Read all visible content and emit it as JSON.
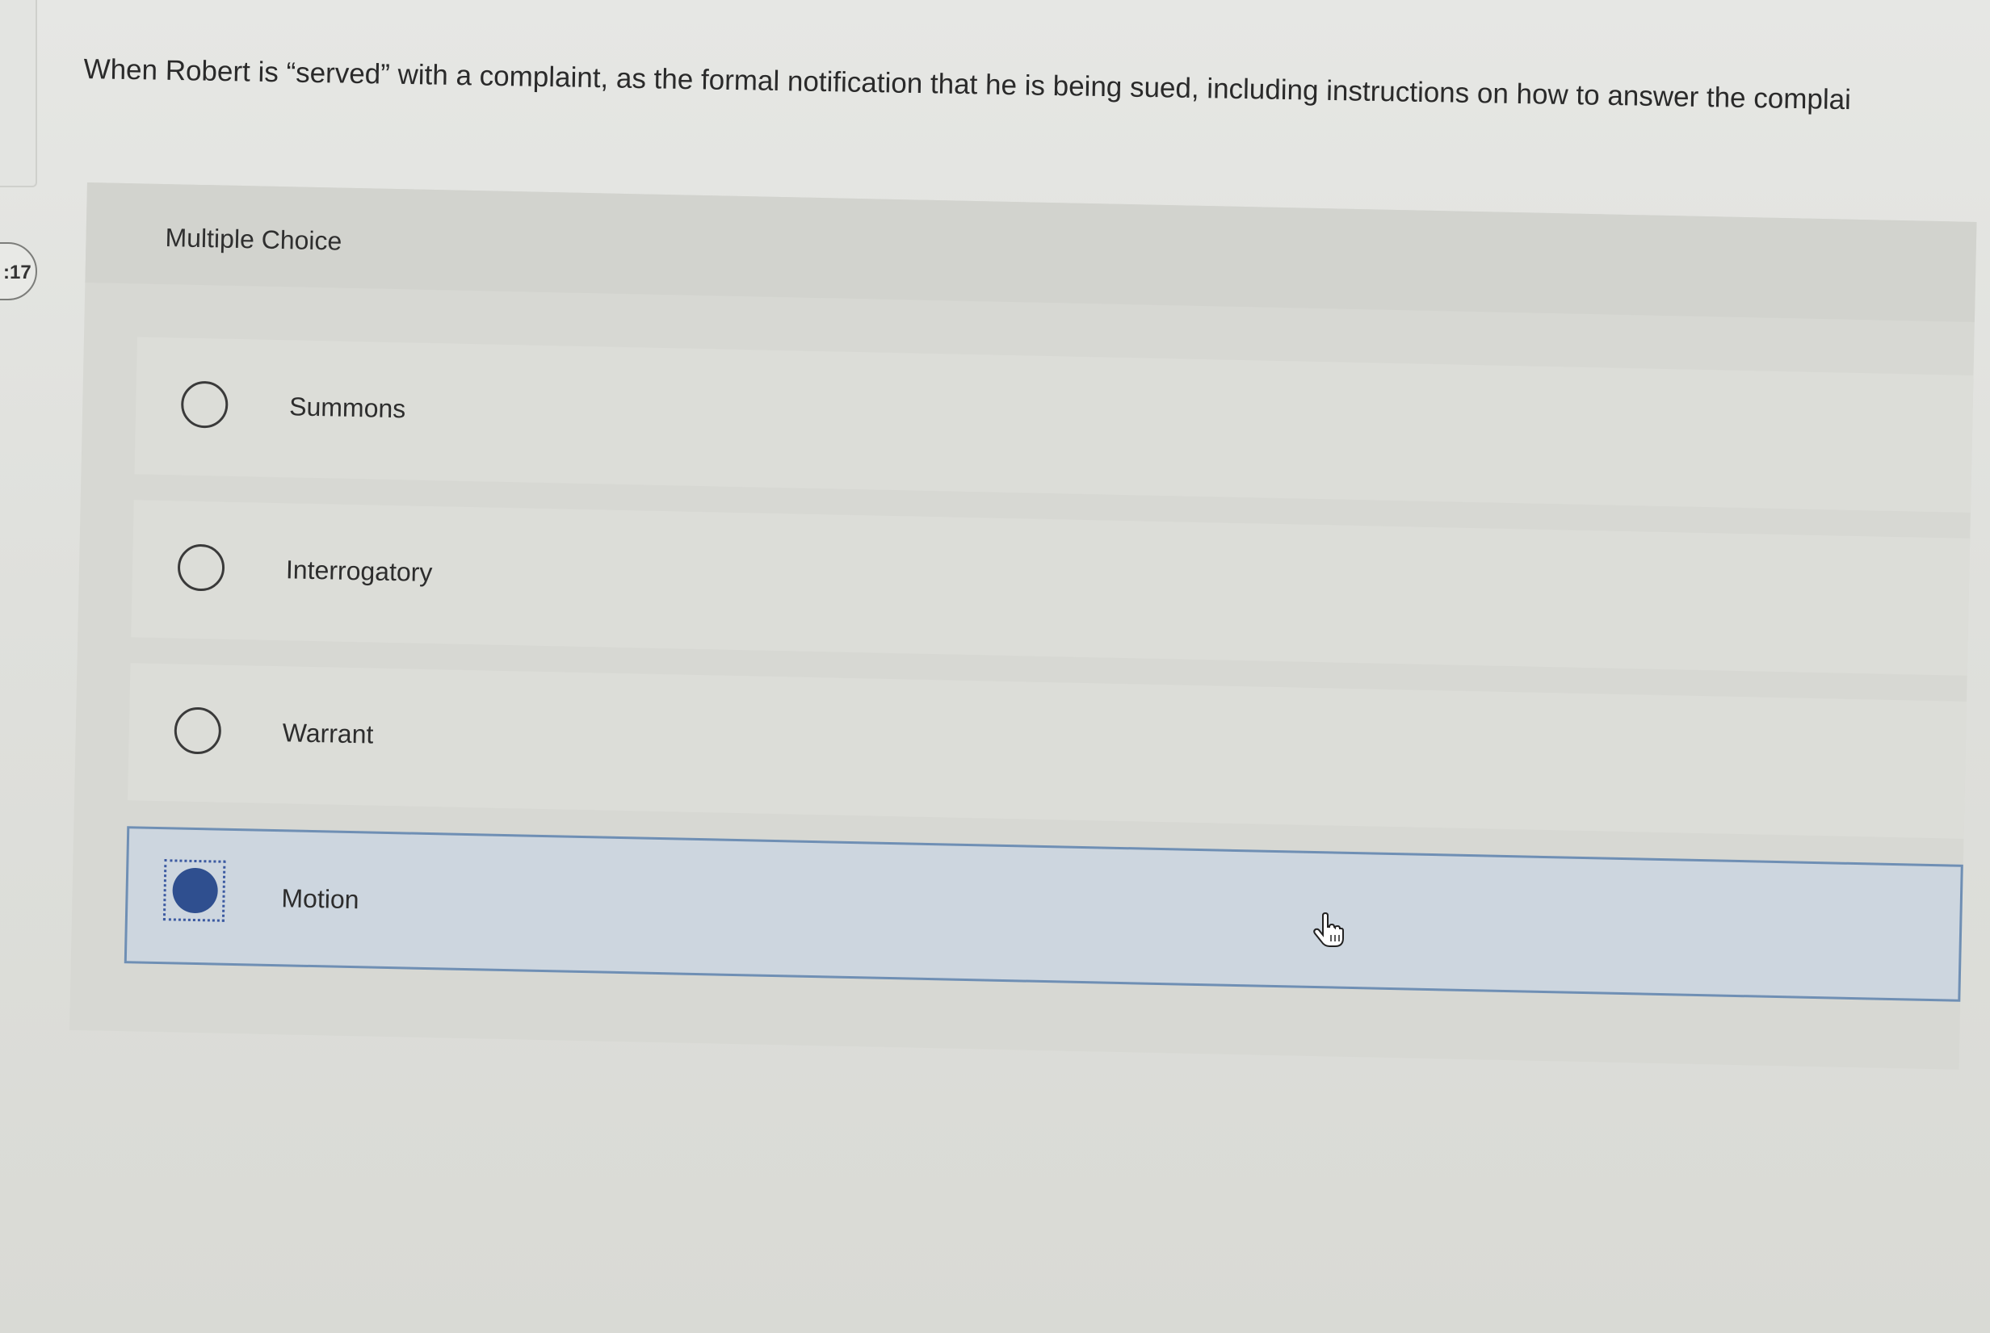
{
  "timer": {
    "text": ":17"
  },
  "question": {
    "text": "When Robert is “served” with a complaint, as the formal notification that he is being sued, including instructions on how to answer the complai"
  },
  "mc": {
    "label": "Multiple Choice",
    "options": [
      {
        "label": "Summons",
        "selected": false
      },
      {
        "label": "Interrogatory",
        "selected": false
      },
      {
        "label": "Warrant",
        "selected": false
      },
      {
        "label": "Motion",
        "selected": true
      }
    ]
  },
  "colors": {
    "accent": "#2f4f8f",
    "selected_bg": "#cdd6df",
    "selected_border": "#6f8fb4"
  },
  "icons": {
    "cursor": "hand-pointer-icon"
  }
}
